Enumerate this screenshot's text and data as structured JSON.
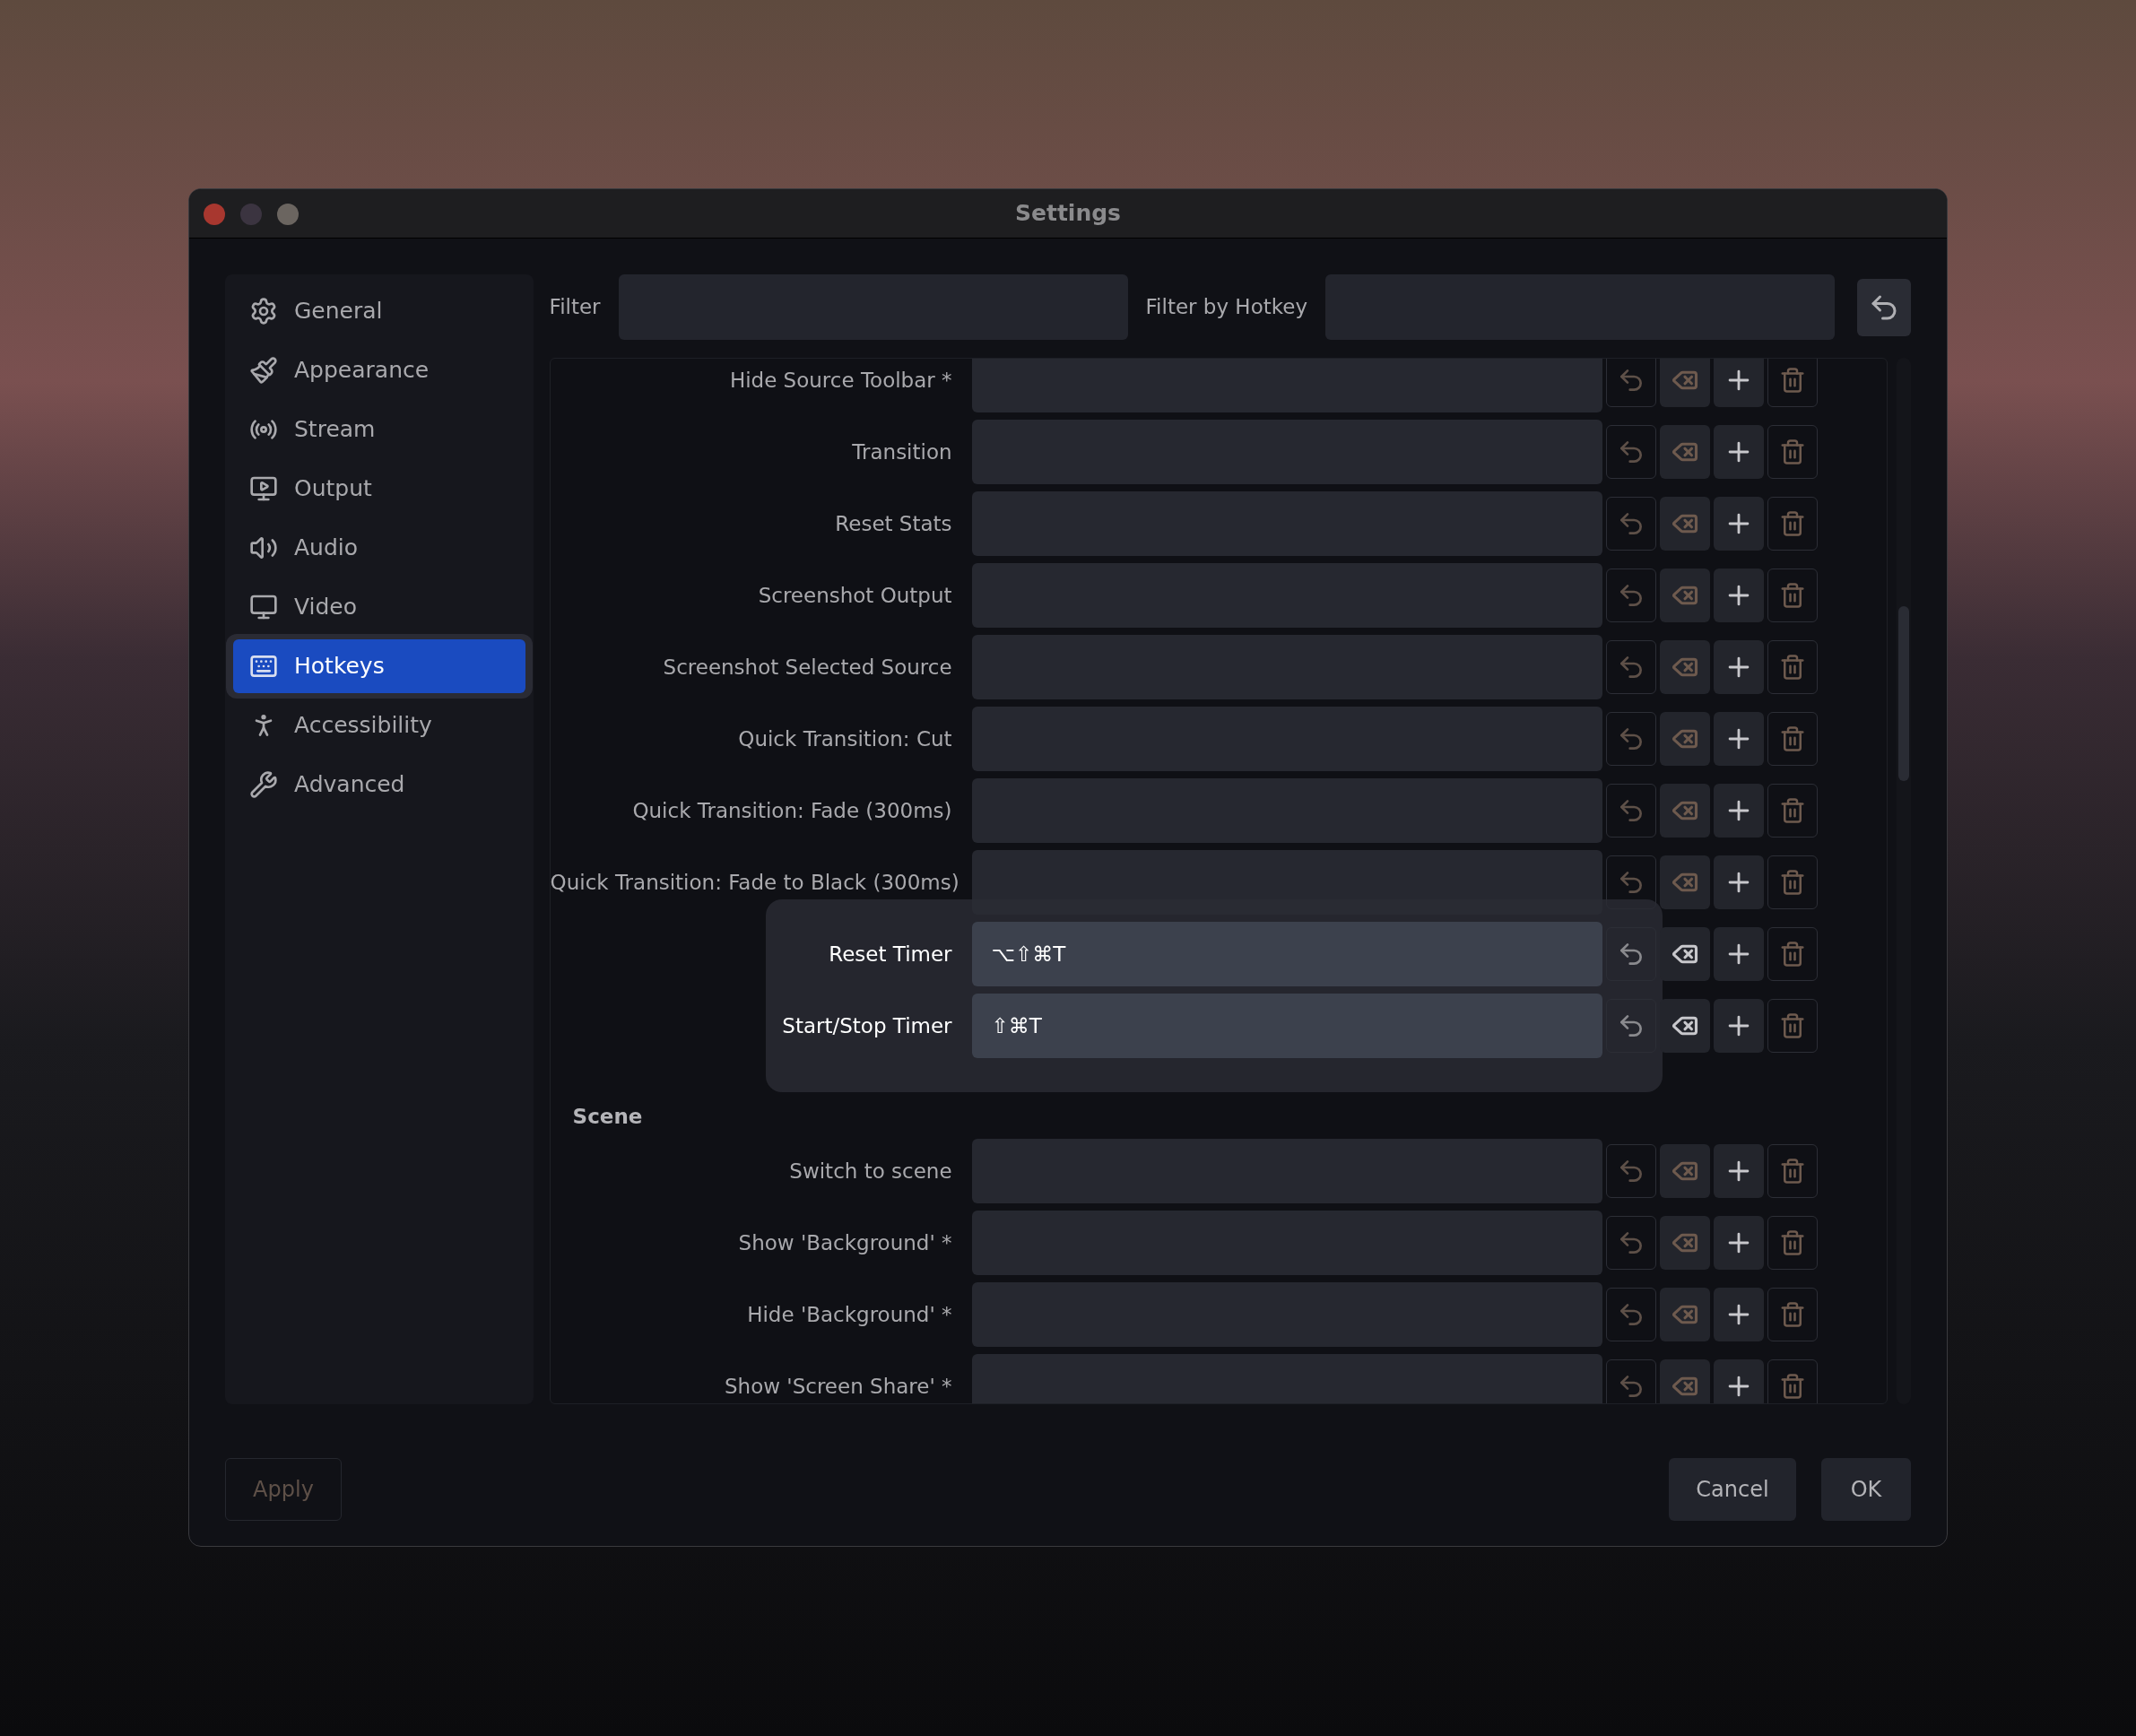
{
  "window": {
    "title": "Settings"
  },
  "sidebar": {
    "items": [
      {
        "label": "General",
        "selected": false
      },
      {
        "label": "Appearance",
        "selected": false
      },
      {
        "label": "Stream",
        "selected": false
      },
      {
        "label": "Output",
        "selected": false
      },
      {
        "label": "Audio",
        "selected": false
      },
      {
        "label": "Video",
        "selected": false
      },
      {
        "label": "Hotkeys",
        "selected": true
      },
      {
        "label": "Accessibility",
        "selected": false
      },
      {
        "label": "Advanced",
        "selected": false
      }
    ]
  },
  "filters": [
    {
      "label": "Filter"
    },
    {
      "label": "Filter by Hotkey"
    }
  ],
  "sections": [
    {
      "rows": [
        {
          "label": "Hide Source Toolbar *",
          "value": "",
          "highlighted": false
        },
        {
          "label": "Transition",
          "value": "",
          "highlighted": false
        },
        {
          "label": "Reset Stats",
          "value": "",
          "highlighted": false
        },
        {
          "label": "Screenshot Output",
          "value": "",
          "highlighted": false
        },
        {
          "label": "Screenshot Selected Source",
          "value": "",
          "highlighted": false
        },
        {
          "label": "Quick Transition: Cut",
          "value": "",
          "highlighted": false
        },
        {
          "label": "Quick Transition: Fade (300ms)",
          "value": "",
          "highlighted": false
        },
        {
          "label": "Quick Transition: Fade to Black (300ms)",
          "value": "",
          "highlighted": false
        },
        {
          "label": "Reset Timer",
          "value": "⌥⇧⌘T",
          "highlighted": true
        },
        {
          "label": "Start/Stop Timer",
          "value": "⇧⌘T",
          "highlighted": true
        }
      ]
    },
    {
      "title": "Scene",
      "rows": [
        {
          "label": "Switch to scene",
          "value": "",
          "highlighted": false
        },
        {
          "label": "Show 'Background' *",
          "value": "",
          "highlighted": false
        },
        {
          "label": "Hide 'Background' *",
          "value": "",
          "highlighted": false
        },
        {
          "label": "Show 'Screen Share' *",
          "value": "",
          "highlighted": false
        }
      ]
    }
  ],
  "buttons": [
    {
      "label": "Apply",
      "disabled": true
    },
    {
      "label": "Cancel",
      "disabled": false
    },
    {
      "label": "OK",
      "disabled": false
    }
  ]
}
